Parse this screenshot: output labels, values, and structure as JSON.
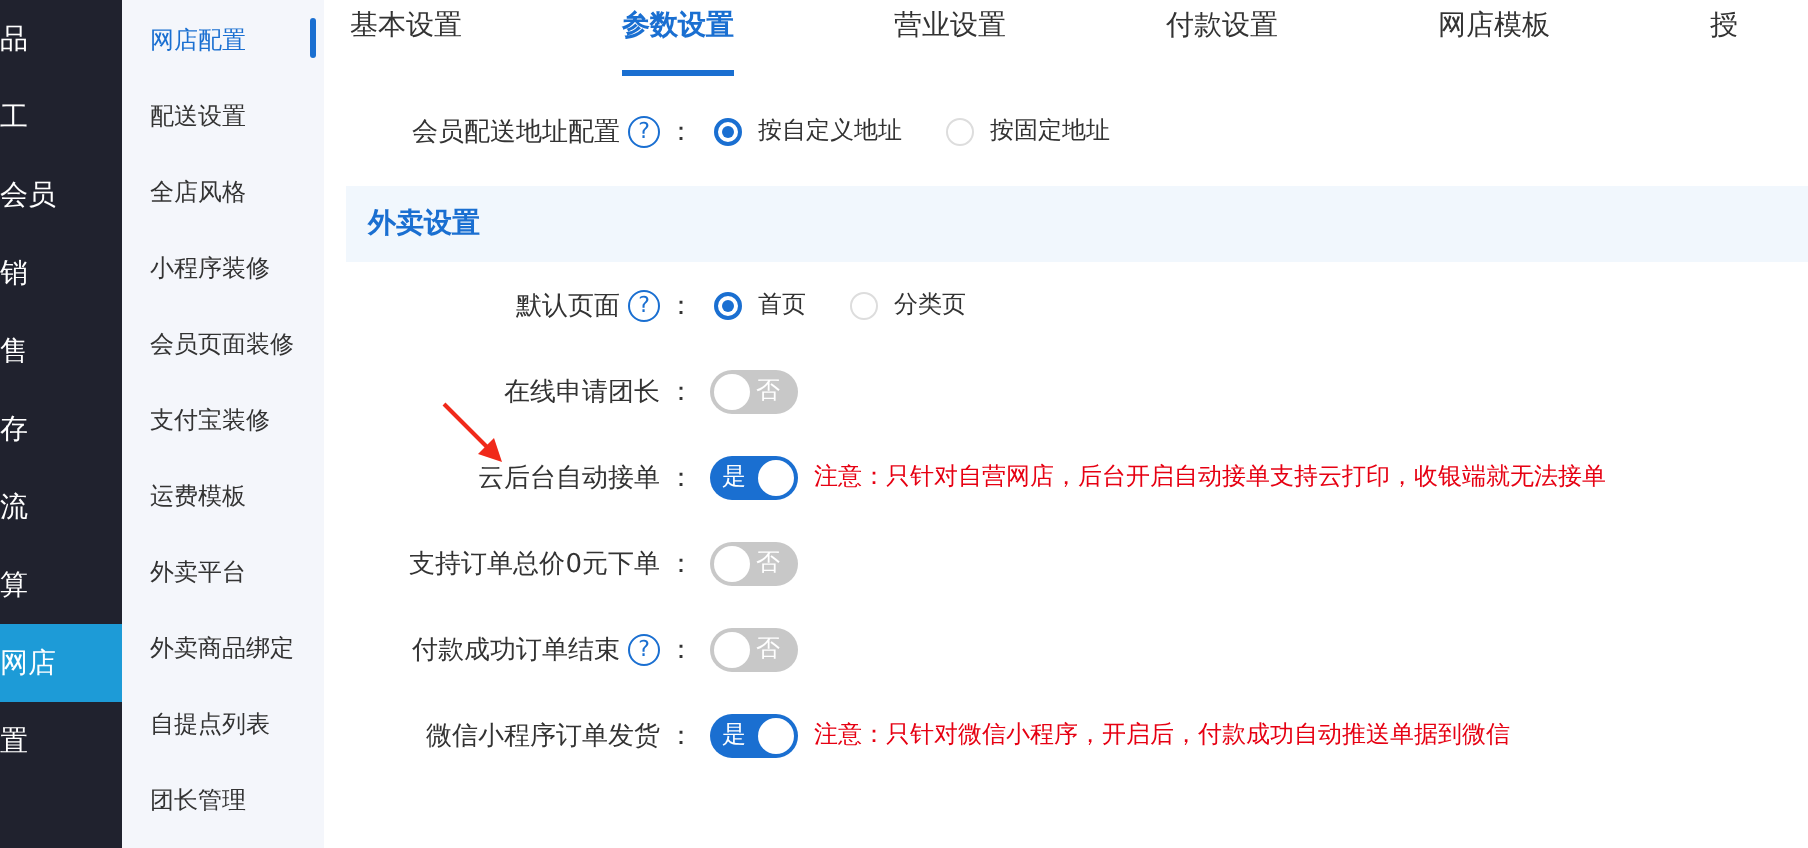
{
  "main_nav": [
    {
      "label": "品",
      "selected": false
    },
    {
      "label": "工",
      "selected": false
    },
    {
      "label": "会员",
      "selected": false
    },
    {
      "label": "销",
      "selected": false
    },
    {
      "label": "售",
      "selected": false
    },
    {
      "label": "存",
      "selected": false
    },
    {
      "label": "流",
      "selected": false
    },
    {
      "label": "算",
      "selected": false
    },
    {
      "label": "网店",
      "selected": true
    },
    {
      "label": "置",
      "selected": false
    }
  ],
  "sub_nav": [
    {
      "label": "网店配置",
      "selected": true
    },
    {
      "label": "配送设置",
      "selected": false
    },
    {
      "label": "全店风格",
      "selected": false
    },
    {
      "label": "小程序装修",
      "selected": false
    },
    {
      "label": "会员页面装修",
      "selected": false
    },
    {
      "label": "支付宝装修",
      "selected": false
    },
    {
      "label": "运费模板",
      "selected": false
    },
    {
      "label": "外卖平台",
      "selected": false
    },
    {
      "label": "外卖商品绑定",
      "selected": false
    },
    {
      "label": "自提点列表",
      "selected": false
    },
    {
      "label": "团长管理",
      "selected": false
    }
  ],
  "tabs": [
    {
      "label": "基本设置",
      "selected": false
    },
    {
      "label": "参数设置",
      "selected": true
    },
    {
      "label": "营业设置",
      "selected": false
    },
    {
      "label": "付款设置",
      "selected": false
    },
    {
      "label": "网店模板",
      "selected": false
    },
    {
      "label": "授",
      "selected": false
    }
  ],
  "settings": [
    {
      "kind": "radio",
      "label": "会员配送地址配置",
      "help": "?",
      "colon": "：",
      "options": [
        {
          "label": "按自定义地址",
          "selected": true
        },
        {
          "label": "按固定地址",
          "selected": false
        }
      ]
    },
    {
      "kind": "section",
      "title": "外卖设置"
    },
    {
      "kind": "radio",
      "label": "默认页面",
      "help": "?",
      "colon": "：",
      "options": [
        {
          "label": "首页",
          "selected": true
        },
        {
          "label": "分类页",
          "selected": false
        }
      ]
    },
    {
      "kind": "toggle",
      "label": "在线申请团长",
      "colon": "：",
      "on": false,
      "toggle_text": "否"
    },
    {
      "kind": "toggle",
      "label": "云后台自动接单",
      "colon": "：",
      "on": true,
      "toggle_text": "是",
      "note": "注意：只针对自营网店，后台开启自动接单支持云打印，收银端就无法接单"
    },
    {
      "kind": "toggle",
      "label": "支持订单总价0元下单",
      "colon": "：",
      "on": false,
      "toggle_text": "否"
    },
    {
      "kind": "toggle",
      "label": "付款成功订单结束",
      "help": "?",
      "colon": "：",
      "on": false,
      "toggle_text": "否"
    },
    {
      "kind": "toggle",
      "label": "微信小程序订单发货",
      "colon": "：",
      "on": true,
      "toggle_text": "是",
      "note": "注意：只针对微信小程序，开启后，付款成功自动推送单据到微信"
    }
  ]
}
